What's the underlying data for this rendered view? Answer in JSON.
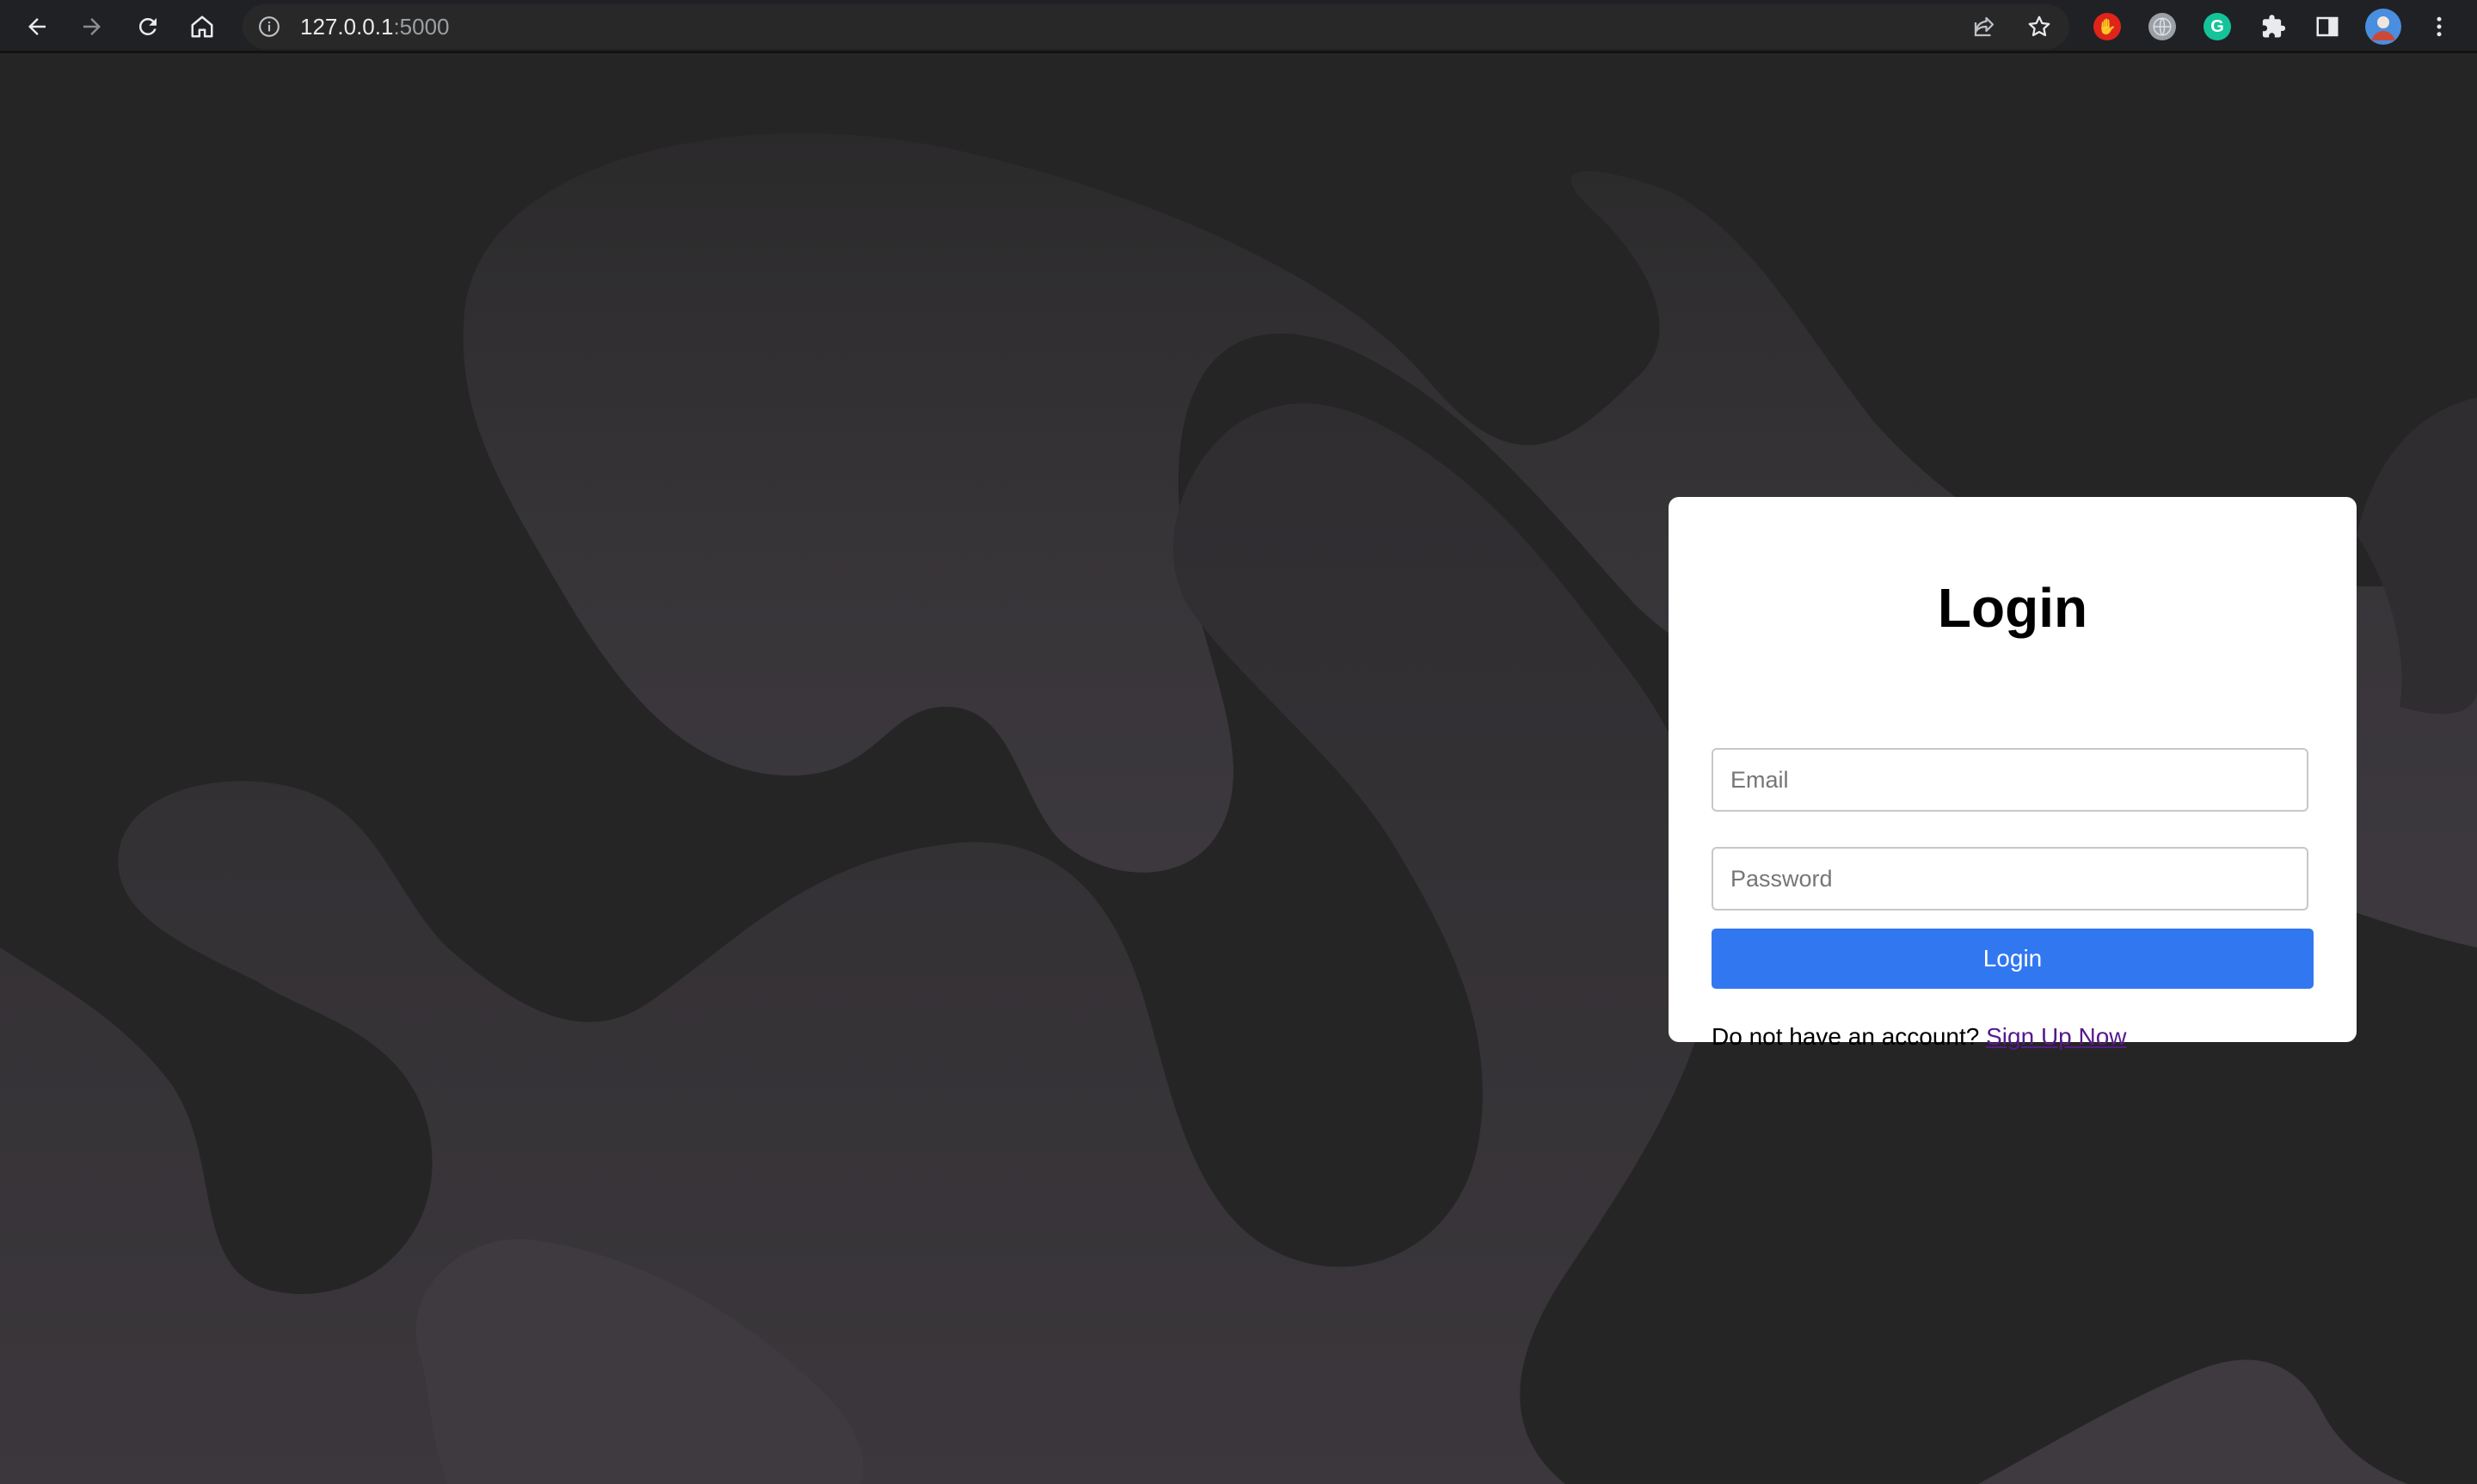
{
  "browser": {
    "url_host": "127.0.0.1",
    "url_port": ":5000",
    "nav_icons": [
      "back-arrow-icon",
      "forward-arrow-icon",
      "reload-icon",
      "home-icon"
    ],
    "omnibox_icons": [
      "info-icon",
      "share-icon",
      "star-icon"
    ],
    "extensions": [
      {
        "name": "adblock-extension-icon",
        "color": "#e0241b",
        "glyph": "✋"
      },
      {
        "name": "globe-extension-icon",
        "color": "#9aa0a6",
        "glyph": ""
      },
      {
        "name": "grammarly-extension-icon",
        "color": "#15c39a",
        "glyph": "G"
      }
    ],
    "toolbar_icons": [
      "extensions-puzzle-icon",
      "side-panel-icon",
      "profile-avatar",
      "more-menu-icon"
    ]
  },
  "login": {
    "title": "Login",
    "email_placeholder": "Email",
    "password_placeholder": "Password",
    "button_label": "Login",
    "signup_prompt": "Do not have an account?",
    "signup_link": "Sign Up Now"
  },
  "colors": {
    "page_background": "#262525",
    "blob_fill": "#3b373c",
    "button": "#3178f0",
    "link": "#551a8b"
  }
}
